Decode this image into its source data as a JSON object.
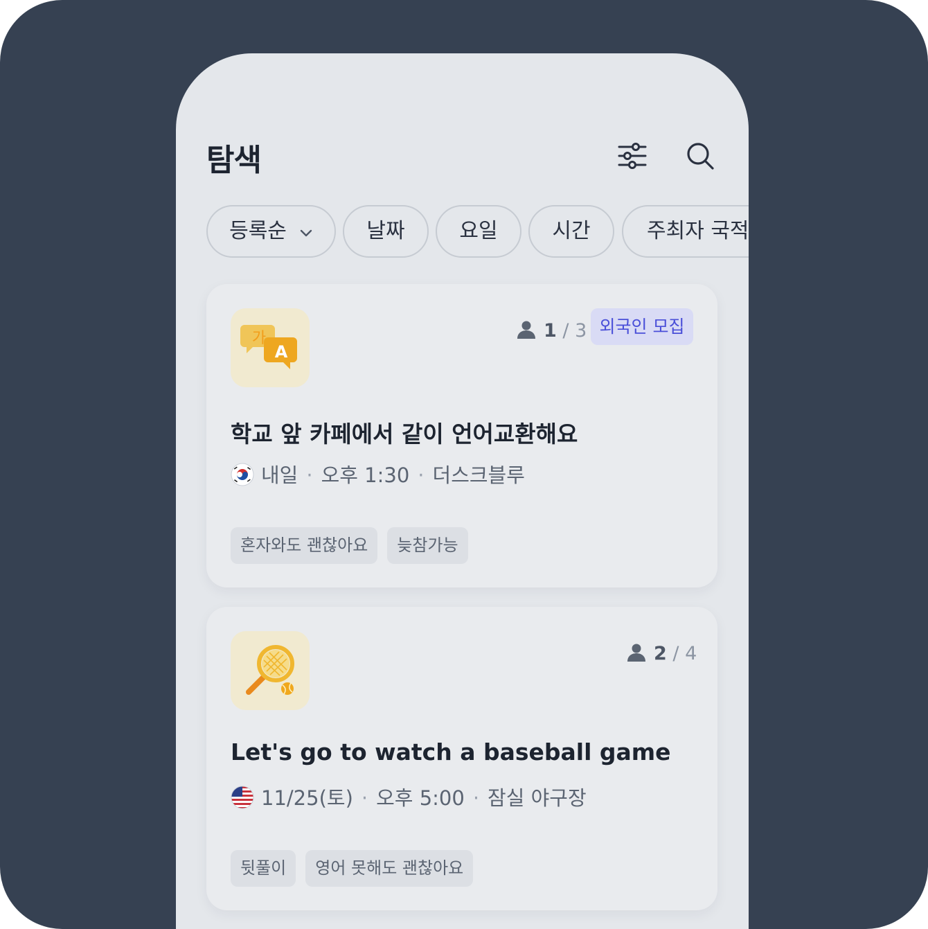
{
  "header": {
    "title": "탐색"
  },
  "filters": {
    "sort": "등록순",
    "date": "날짜",
    "day": "요일",
    "time": "시간",
    "host_nationality": "주최자 국적"
  },
  "cards": [
    {
      "icon": "language-exchange-icon",
      "members_current": "1",
      "members_sep": " / ",
      "members_max": "3",
      "badge": "외국인 모집",
      "title": "학교 앞 카페에서 같이 언어교환해요",
      "flag": "korea-flag-icon",
      "date": "내일",
      "time": "오후 1:30",
      "place": "더스크블루",
      "tags": [
        "혼자와도 괜찮아요",
        "늦참가능"
      ]
    },
    {
      "icon": "tennis-racket-icon",
      "members_current": "2",
      "members_sep": " / ",
      "members_max": "4",
      "title": "Let's go to watch a baseball game",
      "flag": "usa-flag-icon",
      "date": "11/25(토)",
      "time": "오후 5:00",
      "place": "잠실 야구장",
      "tags": [
        "뒷풀이",
        "영어 못해도 괜찮아요"
      ]
    }
  ],
  "meta_separator": "·",
  "colors": {
    "background": "#364152",
    "phone": "#e4e7eb",
    "card": "#e9ebee",
    "badge_bg": "#d9dbf5",
    "badge_text": "#4a4fd8",
    "thumb_bg": "#f1ead0"
  }
}
